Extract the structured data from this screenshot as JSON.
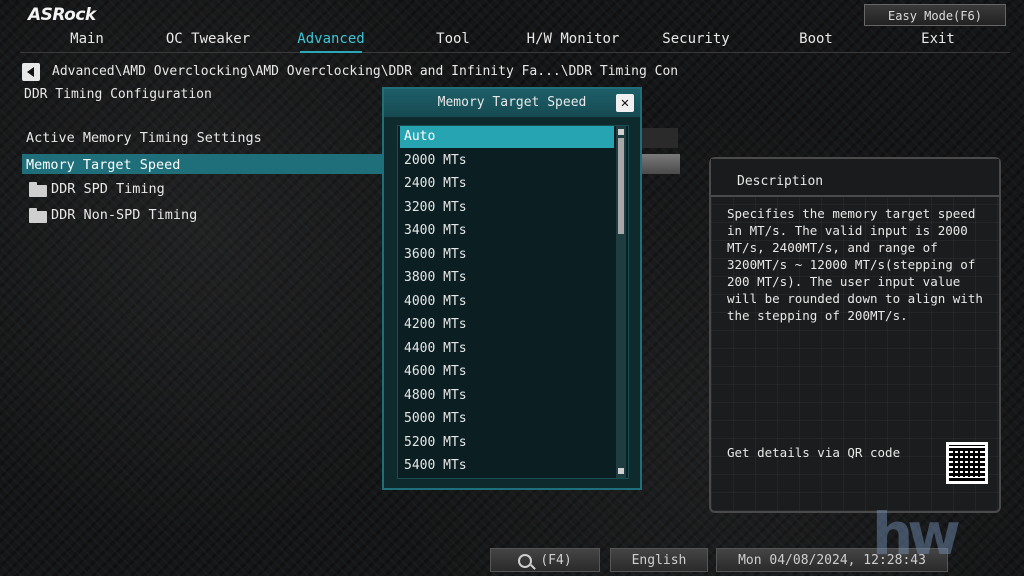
{
  "brand": "ASRock",
  "easy_mode": "Easy Mode(F6)",
  "nav": {
    "tabs": [
      "Main",
      "OC Tweaker",
      "Advanced",
      "Tool",
      "H/W Monitor",
      "Security",
      "Boot",
      "Exit"
    ],
    "active": "Advanced"
  },
  "breadcrumb": "Advanced\\AMD Overclocking\\AMD Overclocking\\DDR and Infinity Fa...\\DDR Timing Con",
  "page_title": "DDR Timing Configuration",
  "settings": {
    "section_label": "Active Memory Timing Settings",
    "selected_item": "Memory Target Speed",
    "submenus": [
      "DDR SPD Timing",
      "DDR Non-SPD Timing"
    ]
  },
  "dialog": {
    "title": "Memory Target Speed",
    "close_label": "✕",
    "options": [
      "Auto",
      "2000 MTs",
      "2400 MTs",
      "3200 MTs",
      "3400 MTs",
      "3600 MTs",
      "3800 MTs",
      "4000 MTs",
      "4200 MTs",
      "4400 MTs",
      "4600 MTs",
      "4800 MTs",
      "5000 MTs",
      "5200 MTs",
      "5400 MTs"
    ],
    "selected": "Auto"
  },
  "description": {
    "title": "Description",
    "text": "Specifies the memory target speed in MT/s. The valid input is 2000 MT/s, 2400MT/s, and range of 3200MT/s ~ 12000 MT/s(stepping of 200 MT/s). The user input value will be rounded down to align with the stepping of 200MT/s.",
    "qr_label": "Get details via QR code"
  },
  "bottom": {
    "search_label": "(F4)",
    "language": "English",
    "datetime": "Mon 04/08/2024, 12:28:43"
  },
  "watermark": "hw",
  "colors": {
    "accent": "#26a4b2",
    "selection_row": "#1f6f7b",
    "active_tab": "#3ec6d8"
  }
}
